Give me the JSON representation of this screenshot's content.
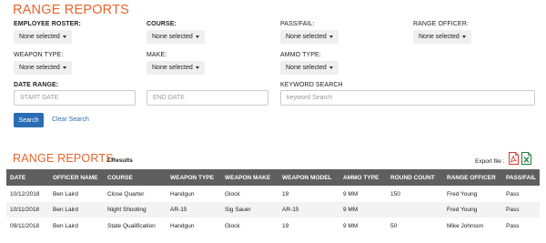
{
  "page": {
    "title": "RANGE REPORTS"
  },
  "filters": {
    "employee_roster": {
      "label": "EMPLOYEE ROSTER:",
      "value": "None selected"
    },
    "course": {
      "label": "COURSE:",
      "value": "None selected"
    },
    "pass_fail": {
      "label": "PASS/FAIL:",
      "value": "None selected"
    },
    "range_officer": {
      "label": "RANGE OFFICER:",
      "value": "None selected"
    },
    "weapon_type": {
      "label": "WEAPON TYPE:",
      "value": "None selected"
    },
    "make": {
      "label": "MAKE:",
      "value": "None selected"
    },
    "ammo_type": {
      "label": "AMMO TYPE:",
      "value": "None selected"
    },
    "date_range": {
      "label": "DATE RANGE:",
      "start_placeholder": "START DATE",
      "end_placeholder": "END DATE"
    },
    "keyword_search": {
      "label": "KEYWORD SEARCH",
      "placeholder": "keyword Search"
    }
  },
  "actions": {
    "search_label": "Search",
    "clear_label": "Clear Search"
  },
  "results": {
    "title": "RANGE REPORTS",
    "count_label": "3 Results",
    "export_label": "Export file :",
    "export_pdf_icon": "pdf-file-icon",
    "export_excel_icon": "excel-file-icon",
    "columns": [
      "DATE",
      "OFFICER NAME",
      "COURSE",
      "WEAPON TYPE",
      "WEAPON MAKE",
      "WEAPON MODEL",
      "AMMO TYPE",
      "ROUND COUNT",
      "RANGE OFFICER",
      "PASS/FAIL"
    ],
    "rows": [
      [
        "10/12/2018",
        "Ben Laird",
        "Close Quarter",
        "Handgun",
        "Glock",
        "19",
        "9 MM",
        "150",
        "Fred Young",
        "Pass"
      ],
      [
        "10/11/2018",
        "Ben Laird",
        "Night Shooting",
        "AR-15",
        "Sig Sauer",
        "AR-15",
        "9 MM",
        "",
        "Fred Young",
        "Pass"
      ],
      [
        "09/11/2018",
        "Ben Laird",
        "State Qualification",
        "Handgun",
        "Glock",
        "19",
        "9 MM",
        "50",
        "Mike Johnson",
        "Pass"
      ]
    ]
  },
  "colors": {
    "accent": "#e8632a",
    "primary": "#2a6db5",
    "header_bg": "#5f5f5f",
    "pdf_red": "#d9342b",
    "excel_green": "#1f7a3f"
  }
}
